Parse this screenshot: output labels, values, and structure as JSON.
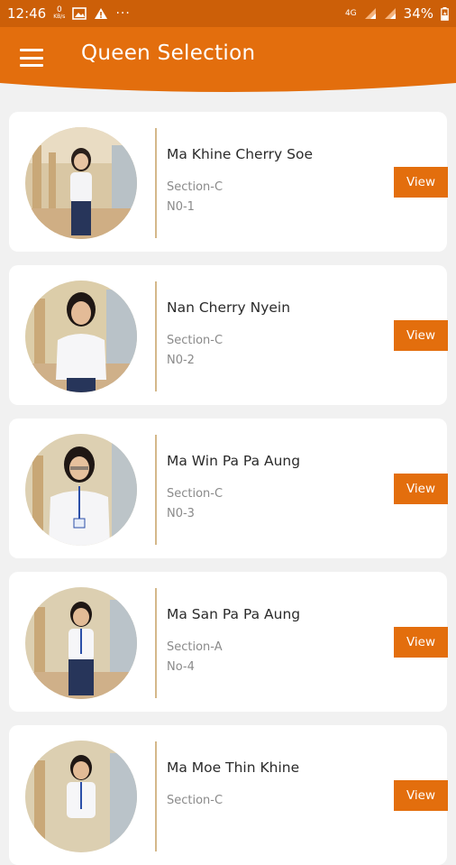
{
  "status_bar": {
    "time": "12:46",
    "data_speed": "0",
    "data_unit": "KB/s",
    "more": "···",
    "network": "4G",
    "battery": "34%"
  },
  "app_bar": {
    "title": "Queen Selection"
  },
  "candidates": [
    {
      "name": "Ma Khine Cherry Soe",
      "section": "Section-C",
      "number": "N0-1",
      "button": "View"
    },
    {
      "name": "Nan Cherry Nyein",
      "section": "Section-C",
      "number": "N0-2",
      "button": "View"
    },
    {
      "name": "Ma Win Pa Pa Aung",
      "section": "Section-C",
      "number": "N0-3",
      "button": "View"
    },
    {
      "name": "Ma San Pa Pa Aung",
      "section": "Section-A",
      "number": "No-4",
      "button": "View"
    },
    {
      "name": "Ma Moe Thin Khine",
      "section": "Section-C",
      "number": "",
      "button": "View"
    }
  ],
  "colors": {
    "status_bar": "#cc5f08",
    "app_bar": "#e36e0d",
    "accent_divider": "#d4b88a",
    "background": "#f1f1f1"
  }
}
